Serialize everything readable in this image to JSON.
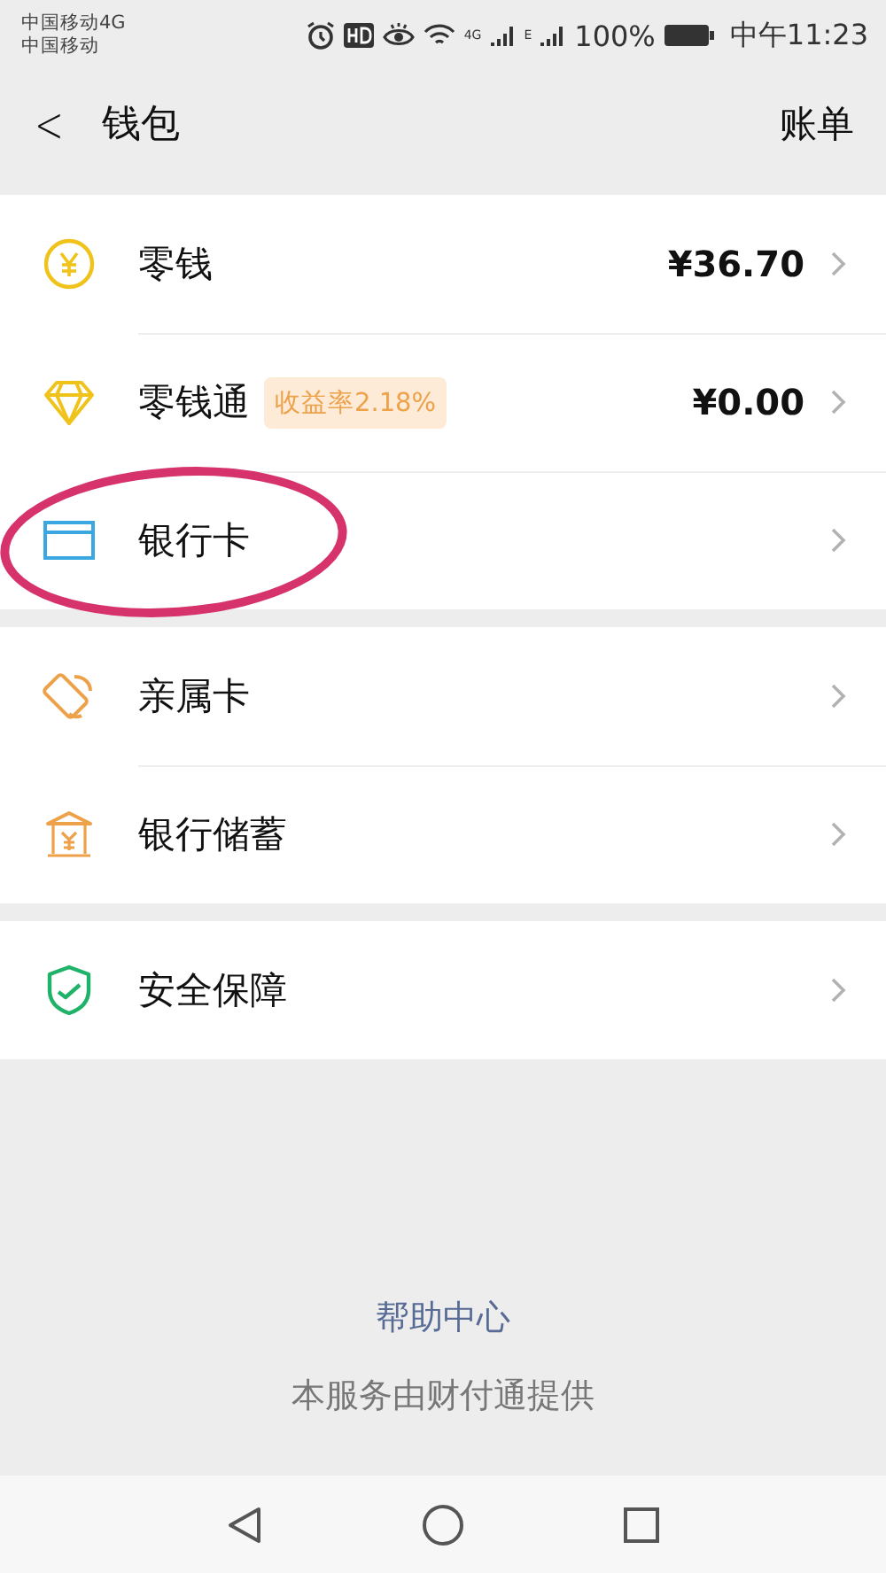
{
  "status_bar": {
    "carriers": [
      "中国移动4G",
      "中国移动"
    ],
    "network_1": "4G",
    "network_2": "E",
    "battery": "100%",
    "time": "中午11:23"
  },
  "header": {
    "back": "<",
    "title": "钱包",
    "action": "账单"
  },
  "sections": [
    {
      "items": [
        {
          "kind": "coin",
          "label": "零钱",
          "amount": "¥36.70",
          "circled": false
        },
        {
          "kind": "diamond",
          "label": "零钱通",
          "badge": "收益率2.18%",
          "amount": "¥0.00",
          "circled": false
        },
        {
          "kind": "card",
          "label": "银行卡",
          "circled": true
        }
      ]
    },
    {
      "items": [
        {
          "kind": "family",
          "label": "亲属卡",
          "circled": false
        },
        {
          "kind": "bank",
          "label": "银行储蓄",
          "circled": false
        }
      ]
    },
    {
      "items": [
        {
          "kind": "shield",
          "label": "安全保障",
          "circled": false
        }
      ]
    }
  ],
  "footer": {
    "help": "帮助中心",
    "provider": "本服务由财付通提供"
  }
}
